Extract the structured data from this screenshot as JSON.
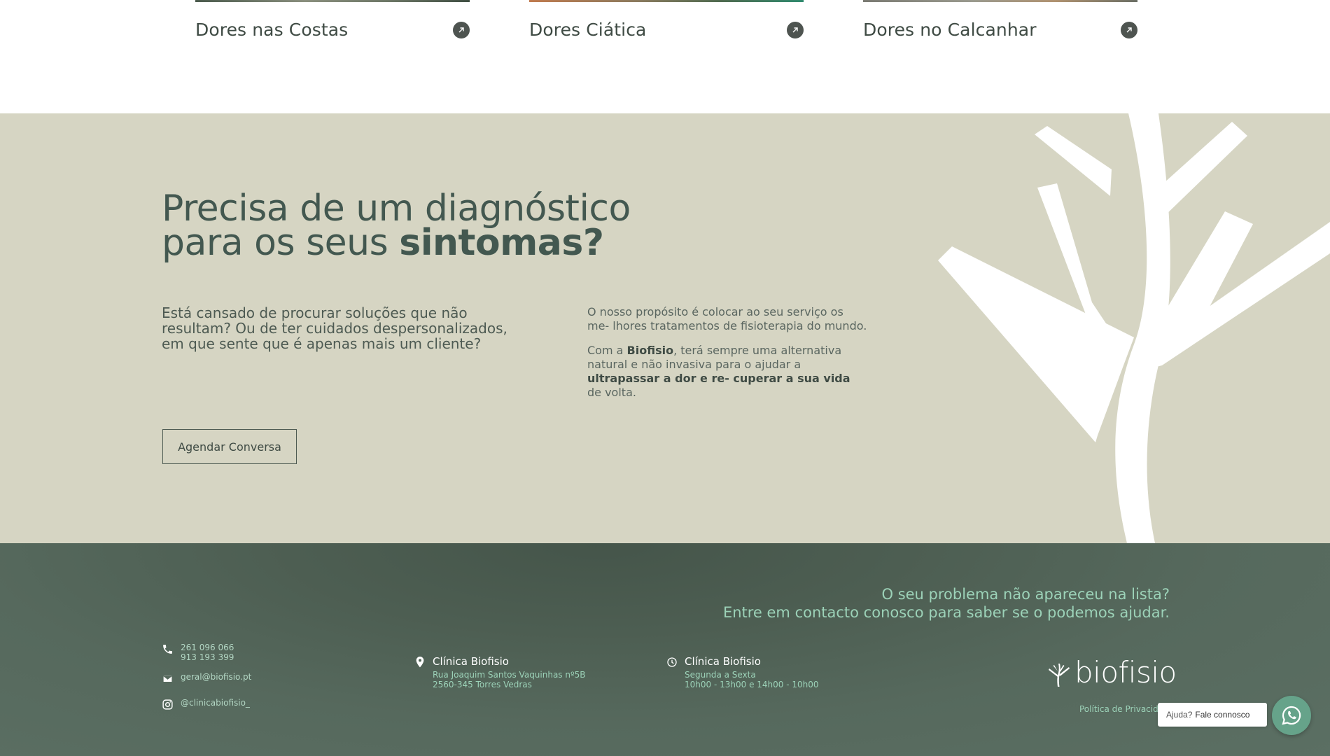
{
  "cards": [
    {
      "title": "Dores nas Costas"
    },
    {
      "title": "Dores Ciática"
    },
    {
      "title": "Dores no Calcanhar"
    }
  ],
  "diagnostic": {
    "heading_line1": "Precisa de um diagnóstico",
    "heading_line2_prefix": "para os seus ",
    "heading_line2_bold": "sintomas?",
    "lead": "Está cansado de procurar soluções que não resultam? Ou de ter cuidados despersonalizados, em que sente que é apenas mais um cliente?",
    "p1": "O nosso propósito é colocar ao seu serviço os me- lhores tratamentos de fisioterapia do mundo.",
    "p2_a": "Com a ",
    "p2_brand": "Biofisio",
    "p2_b": ", terá sempre uma alternativa natural e não invasiva para o ajudar a ",
    "p2_bold": "ultrapassar a dor e re- cuperar a sua vida",
    "p2_c": " de volta.",
    "cta": "Agendar Conversa"
  },
  "footer": {
    "ask_line1": "O seu problema não apareceu na lista?",
    "ask_line2": "Entre em contacto conosco para saber se o podemos ajudar.",
    "phone1": "261 096 066",
    "phone2": "913 193 399",
    "email": "geral@biofisio.pt",
    "instagram": "@clinicabiofisio_",
    "address_title": "Clínica Biofisio",
    "address_line1": "Rua Joaquim Santos Vaquinhas nº5B",
    "address_line2": "2560-345 Torres Vedras",
    "hours_title": "Clínica Biofisio",
    "hours_line1": "Segunda a Sexta",
    "hours_line2": "10h00 - 13h00 e 14h00 - 10h00",
    "logo": "biofisio",
    "privacy": "Política de Privacidade"
  },
  "chat": {
    "question": "Ajuda?",
    "label": "Fale connosco"
  },
  "colors": {
    "beige": "#d6d5c3",
    "footer": "#56695d",
    "accent_mint": "#9cd2b8",
    "heading": "#435850"
  }
}
